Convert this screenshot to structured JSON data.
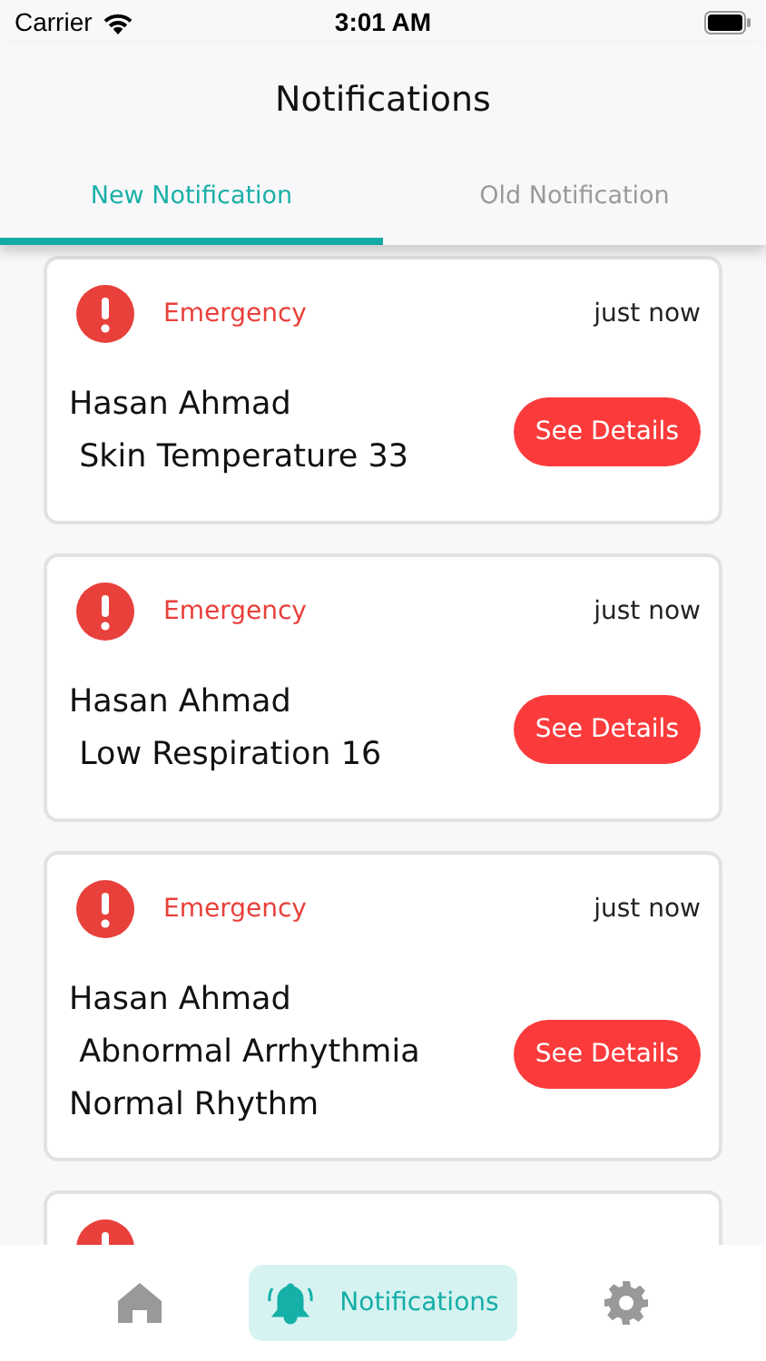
{
  "status_bar": {
    "carrier": "Carrier",
    "time": "3:01 AM"
  },
  "title": "Notifications",
  "tabs": [
    {
      "label": "New Notification",
      "selected": true
    },
    {
      "label": "Old Notification",
      "selected": false
    }
  ],
  "cards": [
    {
      "kind": "emergency",
      "type": "Emergency",
      "time": "just now",
      "lines": [
        "Hasan Ahmad",
        " Skin Temperature 33"
      ],
      "button": "See Details"
    },
    {
      "kind": "emergency",
      "type": "Emergency",
      "time": "just now",
      "lines": [
        "Hasan Ahmad",
        " Low Respiration 16"
      ],
      "button": "See Details"
    },
    {
      "kind": "emergency",
      "type": "Emergency",
      "time": "just now",
      "lines": [
        "Hasan Ahmad",
        " Abnormal Arrhythmia",
        "Normal Rhythm"
      ],
      "button": "See Details"
    },
    {
      "kind": "emergency"
    }
  ],
  "nav": [
    {
      "kind": "home",
      "selected": false
    },
    {
      "kind": "notifications",
      "label": "Notifications",
      "selected": true
    },
    {
      "kind": "settings",
      "selected": false
    }
  ]
}
